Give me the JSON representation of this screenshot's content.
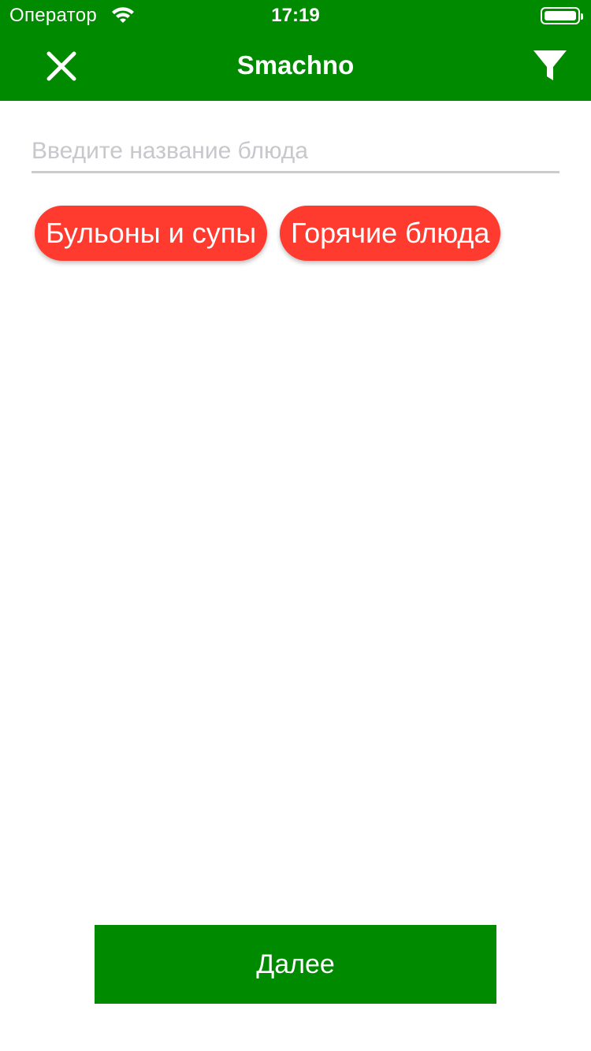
{
  "status_bar": {
    "carrier": "Оператор",
    "time": "17:19"
  },
  "nav": {
    "title": "Smachno"
  },
  "search": {
    "placeholder": "Введите название блюда",
    "value": ""
  },
  "chips": [
    {
      "label": "Бульоны и супы"
    },
    {
      "label": "Горячие блюда"
    }
  ],
  "footer": {
    "next_label": "Далее"
  },
  "colors": {
    "primary_green": "#008a00",
    "chip_red": "#ff3b30",
    "placeholder_gray": "#c7c7cc"
  },
  "icons": {
    "close": "close-icon",
    "filter": "filter-icon",
    "wifi": "wifi-icon",
    "battery": "battery-icon"
  }
}
